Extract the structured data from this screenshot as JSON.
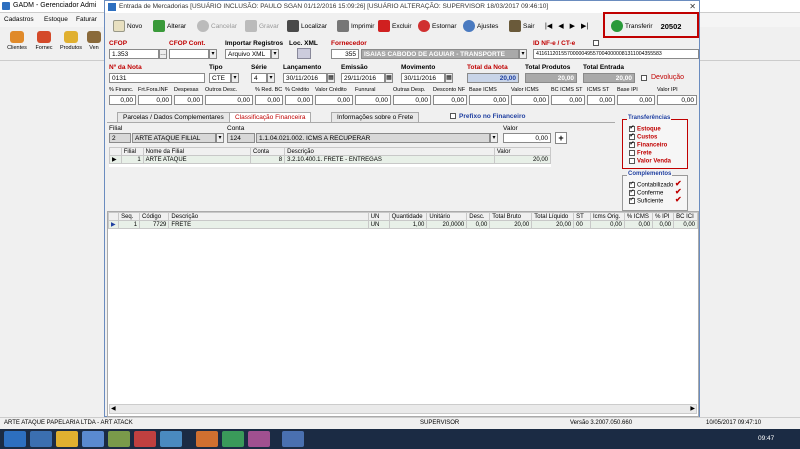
{
  "main_app": {
    "title": "GADM - Gerenciador Admi",
    "menu": [
      "Cadastros",
      "Estoque",
      "Faturar"
    ],
    "toolbar": [
      "Clientes",
      "Fornec",
      "Produtos",
      "Ven"
    ],
    "status": {
      "company": "ARTE ATAQUE PAPELARIA LTDA - ART ATACK",
      "user": "SUPERVISOR",
      "version": "Versão 3.2007.050.660",
      "datetime": "10/05/2017 09:47:10"
    },
    "taskbar_clock": "09:47"
  },
  "dialog": {
    "title": "Entrada de Mercadorias [USUÁRIO INCLUSÃO: PAULO SGAN 01/12/2016 15:09:26] [USUÁRIO ALTERAÇÃO: SUPERVISOR 18/03/2017 09:46:10]",
    "toolbar": {
      "novo": "Novo",
      "alterar": "Alterar",
      "cancelar": "Cancelar",
      "gravar": "Gravar",
      "localizar": "Localizar",
      "imprimir": "Imprimir",
      "excluir": "Excluir",
      "estornar": "Estornar",
      "ajustes": "Ajustes",
      "sair": "Sair",
      "nav_first": "|◀",
      "nav_prev": "◀",
      "nav_next": "▶",
      "nav_last": "▶|",
      "transferir": "Transferir",
      "transfer_number": "20502"
    },
    "header": {
      "cfop_label": "CFOP",
      "cfop_value": "1.353",
      "cfop_cont_label": "CFOP Cont.",
      "importar_label": "Importar Registros",
      "importar_value": "Arquivo XML",
      "loc_xml_label": "Loc. XML",
      "fornecedor_label": "Fornecedor",
      "fornecedor_code": "355",
      "fornecedor_name": "ISAIAS CABODO DE AGUIAR - TRANSPORTE",
      "id_nfe_label": "ID NF-e / CT-e",
      "id_nfe_value": "41161120155700000495570040000081311004355583",
      "nota_label": "Nº da Nota",
      "nota_value": "0131",
      "tipo_label": "Tipo",
      "tipo_value": "CTE",
      "serie_label": "Série",
      "serie_value": "4",
      "lancamento_label": "Lançamento",
      "lancamento_value": "30/11/2016",
      "emissao_label": "Emissão",
      "emissao_value": "29/11/2016",
      "movimento_label": "Movimento",
      "movimento_value": "30/11/2016",
      "total_nota_label": "Total da Nota",
      "total_nota_value": "20,00",
      "total_produtos_label": "Total Produtos",
      "total_produtos_value": "20,00",
      "total_entrada_label": "Total Entrada",
      "total_entrada_value": "20,00",
      "devolucao_label": "Devolução"
    },
    "taxes": {
      "labels": [
        "% Financ.",
        "Frt.Fora.INF",
        "Despesas",
        "Outros Desc.",
        "% Red. BC",
        "% Crédito",
        "Valor Crédito",
        "Funrural",
        "Outras Desp.",
        "Desconto NF",
        "Base ICMS",
        "Valor ICMS",
        "BC ICMS ST",
        "ICMS ST",
        "Base IPI",
        "Valor IPI"
      ],
      "values": [
        "0,00",
        "0,00",
        "0,00",
        "0,00",
        "0,00",
        "0,00",
        "0,00",
        "0,00",
        "0,00",
        "0,00",
        "0,00",
        "0,00",
        "0,00",
        "0,00",
        "0,00",
        "0,00"
      ]
    },
    "tabs": [
      "Parcelas / Dados Complementares",
      "Classificação Financeira",
      "Informações sobre o Frete"
    ],
    "prefixo_label": "Prefixo no Financeiro",
    "classificacao": {
      "filial_label": "Filial",
      "filial_code": "2",
      "filial_name": "ARTE ATAQUE FILIAL",
      "conta_label": "Conta",
      "conta_code": "124",
      "conta_name": "1.1.04.021.002. ICMS A RECUPERAR",
      "valor_label": "Valor",
      "valor_value": "0,00",
      "add_label": "+",
      "columns": [
        "Filial",
        "Nome da Filial",
        "Conta",
        "Descrição",
        "Valor"
      ],
      "rows": [
        {
          "filial": "1",
          "nome": "ARTE ATAQUE",
          "conta": "8",
          "descricao": "3.2.10.400.1. FRETE - ENTREGAS",
          "valor": "20,00"
        }
      ]
    },
    "transferencias": {
      "title": "Transferências",
      "items": [
        {
          "label": "Estoque",
          "checked": true
        },
        {
          "label": "Custos",
          "checked": true
        },
        {
          "label": "Financeiro",
          "checked": true
        },
        {
          "label": "Frete",
          "checked": false
        },
        {
          "label": "Valor Venda",
          "checked": false
        }
      ]
    },
    "complementos": {
      "title": "Complementos",
      "items": [
        {
          "label": "Contabilizado",
          "checked": true
        },
        {
          "label": "Conferme",
          "checked": true
        },
        {
          "label": "Suficiente",
          "checked": true
        }
      ]
    },
    "items_grid": {
      "columns": [
        "Seq.",
        "Código",
        "Descrição",
        "UN",
        "Quantidade",
        "Unitário",
        "Desc.",
        "Total Bruto",
        "Total Líquido",
        "ST",
        "Icms Orig.",
        "% ICMS",
        "% IPI",
        "BC ICI"
      ],
      "rows": [
        {
          "seq": "1",
          "codigo": "7729",
          "descricao": "FRETE",
          "un": "UN",
          "qtd": "1,00",
          "unit": "20,0000",
          "desc": "0,00",
          "bruto": "20,00",
          "liquido": "20,00",
          "st": "00",
          "icms_orig": "0,00",
          "icms": "0,00",
          "ipi": "0,00",
          "bc": "0,00"
        }
      ]
    }
  },
  "colors": {
    "accent_red": "#c00000",
    "dialog_border": "#6a8cbf",
    "taskbar": "#1b2b44"
  }
}
